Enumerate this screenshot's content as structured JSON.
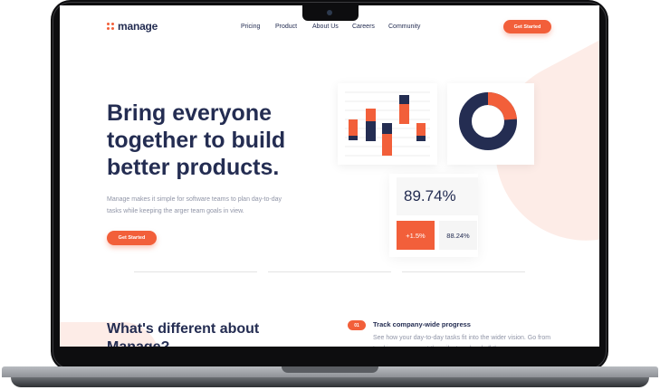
{
  "brand": {
    "name": "manage",
    "accent": "#f25f3a",
    "navy": "#242d52"
  },
  "nav": {
    "items": [
      "Pricing",
      "Product",
      "About Us",
      "Careers",
      "Community"
    ]
  },
  "header": {
    "cta_label": "Get Started"
  },
  "hero": {
    "title": "Bring everyone together to build better products.",
    "description": "Manage makes it simple for software teams to plan day-to-day tasks while keeping the arger team goals in view.",
    "cta_label": "Get Started"
  },
  "stats": {
    "main_value": "89.74%",
    "change": "+1.5%",
    "secondary_value": "88.24%"
  },
  "features": {
    "section_title": "What's different about Manage?",
    "items": [
      {
        "number": "01",
        "title": "Track company-wide progress",
        "description": "See how your day-to-day tasks fit into the wider vision. Go from tracking progress at the milestone level all the"
      }
    ]
  }
}
